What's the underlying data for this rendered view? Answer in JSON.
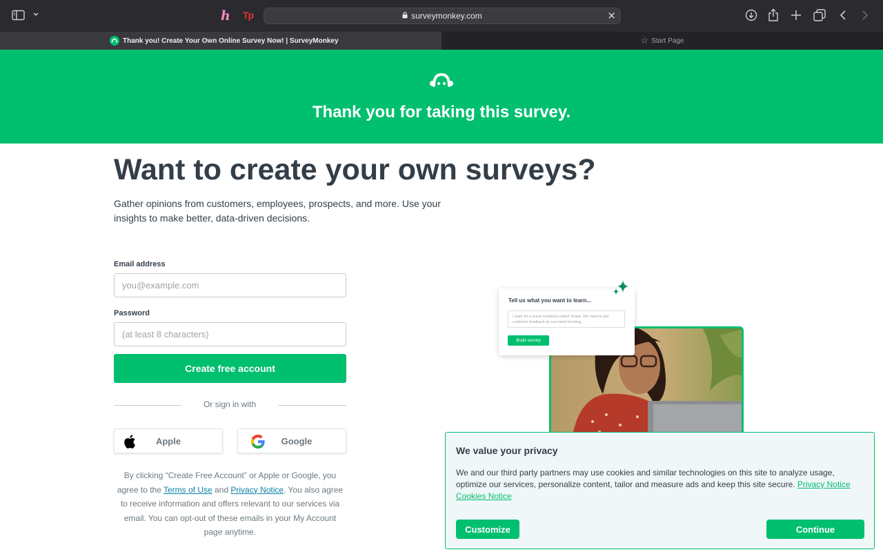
{
  "browser": {
    "url": "surveymonkey.com",
    "tabs": [
      {
        "title": "Thank you! Create Your Own Online Survey Now! | SurveyMonkey"
      },
      {
        "title": "Start Page"
      }
    ],
    "extensions": {
      "honey": "h",
      "tp": "Tp"
    }
  },
  "hero": {
    "title": "Thank you for taking this survey."
  },
  "main": {
    "headline": "Want to create your own surveys?",
    "subtitle": "Gather opinions from customers, employees, prospects, and more. Use your insights to make better, data-driven decisions."
  },
  "form": {
    "email_label": "Email address",
    "email_placeholder": "you@example.com",
    "password_label": "Password",
    "password_placeholder": "(at least 8 characters)",
    "submit_label": "Create free account",
    "or_text": "Or sign in with",
    "apple_label": "Apple",
    "google_label": "Google"
  },
  "legal": {
    "part1": "By clicking “Create Free Account” or Apple or Google, you agree to the ",
    "terms_link": "Terms of Use",
    "part2": " and ",
    "privacy_link": "Privacy Notice",
    "part3": ". You also agree to receive information and offers relevant to our services via email. You can opt-out of these emails in your My Account page anytime."
  },
  "illustration": {
    "card_title": "Tell us what you want to learn...",
    "card_input": "I work for a travel company called Vivara. We need to get customer feedback on our travel booking...",
    "card_button": "Build survey"
  },
  "privacy": {
    "title": "We value your privacy",
    "body": "We and our third party partners may use cookies and similar technologies on this site to analyze usage, optimize our services, personalize content, tailor and measure ads and keep this site secure. ",
    "privacy_link": "Privacy Notice",
    "cookies_link": "Cookies Notice",
    "customize_label": "Customize",
    "continue_label": "Continue"
  },
  "colors": {
    "brand_green": "#00bf6f",
    "text_dark": "#333e48",
    "text_muted": "#6b787f",
    "link_blue": "#0a7fa8"
  }
}
